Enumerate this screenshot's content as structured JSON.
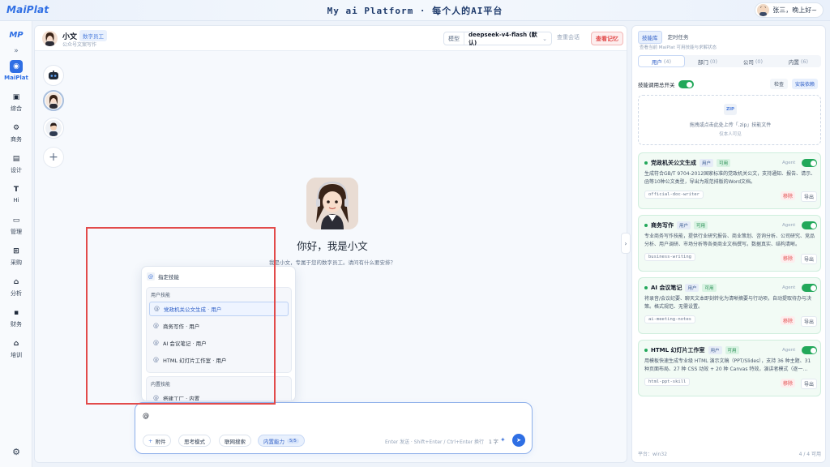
{
  "header": {
    "logo": "MaiPlat",
    "title": "My ai Platform · 每个人的AI平台",
    "user_greeting": "张三，晚上好~"
  },
  "nav": {
    "brand": "MP",
    "collapse_icon": "»",
    "items": [
      {
        "label": "MaiPlat",
        "icon": "chat-icon",
        "glyph": "◉"
      },
      {
        "label": "综合",
        "icon": "save-icon",
        "glyph": "▣"
      },
      {
        "label": "商务",
        "icon": "handshake-icon",
        "glyph": "⚙"
      },
      {
        "label": "设计",
        "icon": "document-icon",
        "glyph": "▤"
      },
      {
        "label": "Hi",
        "icon": "text-icon",
        "glyph": "T"
      },
      {
        "label": "管理",
        "icon": "window-icon",
        "glyph": "▭"
      },
      {
        "label": "采购",
        "icon": "cart-icon",
        "glyph": "⊞"
      },
      {
        "label": "分析",
        "icon": "home-icon",
        "glyph": "⌂"
      },
      {
        "label": "财务",
        "icon": "lock-icon",
        "glyph": "▪"
      },
      {
        "label": "培训",
        "icon": "home-icon",
        "glyph": "⌂"
      }
    ],
    "settings_glyph": "⚙"
  },
  "agent": {
    "name": "小文",
    "badge": "数字员工",
    "subtitle": "公众号文案写作"
  },
  "model": {
    "label": "模型",
    "value": "deepseek-v4-flash (默认)"
  },
  "actions": {
    "review": "查重会话",
    "memory": "查看记忆"
  },
  "welcome": {
    "title": "你好，我是小文",
    "subtitle": "我是小文，专属于您的数字员工。请问有什么要安排？"
  },
  "popup": {
    "header": "指定技能",
    "groups": [
      {
        "title": "用户技能",
        "options": [
          "党政机关公文生成 · 用户",
          "商务写作 · 用户",
          "AI 会议笔记 · 用户",
          "HTML 幻灯片工作室 · 用户"
        ]
      },
      {
        "title": "内置技能",
        "options": [
          "搭建工厂 · 内置"
        ]
      }
    ]
  },
  "composer": {
    "value": "@",
    "chips": {
      "attach": "附件",
      "think": "思考模式",
      "search": "联网搜索",
      "builtin": "内置能力",
      "builtin_count": "5/5"
    },
    "hint": "Enter 发送 · Shift+Enter / Ctrl+Enter 换行",
    "char_count": "1 字"
  },
  "rpanel": {
    "tabs": [
      "技能库",
      "定时任务"
    ],
    "tip": "查看当前 MaiPlat 可用技能与求解状态",
    "subtabs": [
      {
        "label": "用户",
        "count": "(4)"
      },
      {
        "label": "部门",
        "count": "(0)"
      },
      {
        "label": "公司",
        "count": "(0)"
      },
      {
        "label": "内置",
        "count": "(6)"
      }
    ],
    "switch_label": "技能调用总开关",
    "check": "检查",
    "install": "安装依赖",
    "zip": "ZIP",
    "upload_tip": "拖拽或点击此处上传「.zip」技能文件",
    "upload_sub": "仅本人可见",
    "scope_tag": "用户",
    "ok_tag": "可用",
    "agent_label": "Agent",
    "remove": "移除",
    "export": "导出",
    "cards": [
      {
        "title": "党政机关公文生成",
        "desc": "生成符合GB/T 9704-2012国家标准的党政机关公文，支持通知、报告、请示、函等10种公文类型，导出为规范排版的Word文档。",
        "code": "official-doc-writer"
      },
      {
        "title": "商务写作",
        "desc": "专业商务写作技能，提供行业研究报告、商业策划、咨询分析、公司研究、竞品分析、用户调研、市场分析等各类商业文档撰写。数据真实、结构清晰。",
        "code": "business-writing"
      },
      {
        "title": "AI 会议笔记",
        "desc": "将录音/会议纪要、聊天文本即刻转化为清晰摘要与行动项，自动提取待办与决策。格式规范、无需设置。",
        "code": "ai-meeting-notes"
      },
      {
        "title": "HTML 幻灯片工作室",
        "desc": "用模板快速生成专业级 HTML 演示文稿（PPT/Slides），支持 36 种主题、31 种页面布局、27 种 CSS 动效 + 20 种 Canvas 特效，演讲者模式（逐一…",
        "code": "html-ppt-skill"
      }
    ],
    "footer_left": "平台：win32",
    "footer_right": "4 / 4 可用"
  }
}
